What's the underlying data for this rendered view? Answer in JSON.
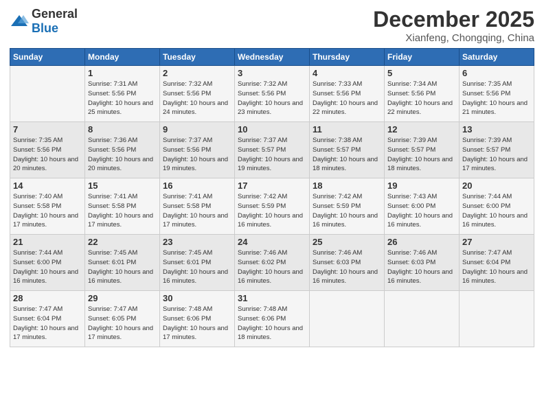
{
  "logo": {
    "general": "General",
    "blue": "Blue"
  },
  "header": {
    "month": "December 2025",
    "location": "Xianfeng, Chongqing, China"
  },
  "columns": [
    "Sunday",
    "Monday",
    "Tuesday",
    "Wednesday",
    "Thursday",
    "Friday",
    "Saturday"
  ],
  "weeks": [
    [
      {
        "day": "",
        "sunrise": "",
        "sunset": "",
        "daylight": ""
      },
      {
        "day": "1",
        "sunrise": "Sunrise: 7:31 AM",
        "sunset": "Sunset: 5:56 PM",
        "daylight": "Daylight: 10 hours and 25 minutes."
      },
      {
        "day": "2",
        "sunrise": "Sunrise: 7:32 AM",
        "sunset": "Sunset: 5:56 PM",
        "daylight": "Daylight: 10 hours and 24 minutes."
      },
      {
        "day": "3",
        "sunrise": "Sunrise: 7:32 AM",
        "sunset": "Sunset: 5:56 PM",
        "daylight": "Daylight: 10 hours and 23 minutes."
      },
      {
        "day": "4",
        "sunrise": "Sunrise: 7:33 AM",
        "sunset": "Sunset: 5:56 PM",
        "daylight": "Daylight: 10 hours and 22 minutes."
      },
      {
        "day": "5",
        "sunrise": "Sunrise: 7:34 AM",
        "sunset": "Sunset: 5:56 PM",
        "daylight": "Daylight: 10 hours and 22 minutes."
      },
      {
        "day": "6",
        "sunrise": "Sunrise: 7:35 AM",
        "sunset": "Sunset: 5:56 PM",
        "daylight": "Daylight: 10 hours and 21 minutes."
      }
    ],
    [
      {
        "day": "7",
        "sunrise": "Sunrise: 7:35 AM",
        "sunset": "Sunset: 5:56 PM",
        "daylight": "Daylight: 10 hours and 20 minutes."
      },
      {
        "day": "8",
        "sunrise": "Sunrise: 7:36 AM",
        "sunset": "Sunset: 5:56 PM",
        "daylight": "Daylight: 10 hours and 20 minutes."
      },
      {
        "day": "9",
        "sunrise": "Sunrise: 7:37 AM",
        "sunset": "Sunset: 5:56 PM",
        "daylight": "Daylight: 10 hours and 19 minutes."
      },
      {
        "day": "10",
        "sunrise": "Sunrise: 7:37 AM",
        "sunset": "Sunset: 5:57 PM",
        "daylight": "Daylight: 10 hours and 19 minutes."
      },
      {
        "day": "11",
        "sunrise": "Sunrise: 7:38 AM",
        "sunset": "Sunset: 5:57 PM",
        "daylight": "Daylight: 10 hours and 18 minutes."
      },
      {
        "day": "12",
        "sunrise": "Sunrise: 7:39 AM",
        "sunset": "Sunset: 5:57 PM",
        "daylight": "Daylight: 10 hours and 18 minutes."
      },
      {
        "day": "13",
        "sunrise": "Sunrise: 7:39 AM",
        "sunset": "Sunset: 5:57 PM",
        "daylight": "Daylight: 10 hours and 17 minutes."
      }
    ],
    [
      {
        "day": "14",
        "sunrise": "Sunrise: 7:40 AM",
        "sunset": "Sunset: 5:58 PM",
        "daylight": "Daylight: 10 hours and 17 minutes."
      },
      {
        "day": "15",
        "sunrise": "Sunrise: 7:41 AM",
        "sunset": "Sunset: 5:58 PM",
        "daylight": "Daylight: 10 hours and 17 minutes."
      },
      {
        "day": "16",
        "sunrise": "Sunrise: 7:41 AM",
        "sunset": "Sunset: 5:58 PM",
        "daylight": "Daylight: 10 hours and 17 minutes."
      },
      {
        "day": "17",
        "sunrise": "Sunrise: 7:42 AM",
        "sunset": "Sunset: 5:59 PM",
        "daylight": "Daylight: 10 hours and 16 minutes."
      },
      {
        "day": "18",
        "sunrise": "Sunrise: 7:42 AM",
        "sunset": "Sunset: 5:59 PM",
        "daylight": "Daylight: 10 hours and 16 minutes."
      },
      {
        "day": "19",
        "sunrise": "Sunrise: 7:43 AM",
        "sunset": "Sunset: 6:00 PM",
        "daylight": "Daylight: 10 hours and 16 minutes."
      },
      {
        "day": "20",
        "sunrise": "Sunrise: 7:44 AM",
        "sunset": "Sunset: 6:00 PM",
        "daylight": "Daylight: 10 hours and 16 minutes."
      }
    ],
    [
      {
        "day": "21",
        "sunrise": "Sunrise: 7:44 AM",
        "sunset": "Sunset: 6:00 PM",
        "daylight": "Daylight: 10 hours and 16 minutes."
      },
      {
        "day": "22",
        "sunrise": "Sunrise: 7:45 AM",
        "sunset": "Sunset: 6:01 PM",
        "daylight": "Daylight: 10 hours and 16 minutes."
      },
      {
        "day": "23",
        "sunrise": "Sunrise: 7:45 AM",
        "sunset": "Sunset: 6:01 PM",
        "daylight": "Daylight: 10 hours and 16 minutes."
      },
      {
        "day": "24",
        "sunrise": "Sunrise: 7:46 AM",
        "sunset": "Sunset: 6:02 PM",
        "daylight": "Daylight: 10 hours and 16 minutes."
      },
      {
        "day": "25",
        "sunrise": "Sunrise: 7:46 AM",
        "sunset": "Sunset: 6:03 PM",
        "daylight": "Daylight: 10 hours and 16 minutes."
      },
      {
        "day": "26",
        "sunrise": "Sunrise: 7:46 AM",
        "sunset": "Sunset: 6:03 PM",
        "daylight": "Daylight: 10 hours and 16 minutes."
      },
      {
        "day": "27",
        "sunrise": "Sunrise: 7:47 AM",
        "sunset": "Sunset: 6:04 PM",
        "daylight": "Daylight: 10 hours and 16 minutes."
      }
    ],
    [
      {
        "day": "28",
        "sunrise": "Sunrise: 7:47 AM",
        "sunset": "Sunset: 6:04 PM",
        "daylight": "Daylight: 10 hours and 17 minutes."
      },
      {
        "day": "29",
        "sunrise": "Sunrise: 7:47 AM",
        "sunset": "Sunset: 6:05 PM",
        "daylight": "Daylight: 10 hours and 17 minutes."
      },
      {
        "day": "30",
        "sunrise": "Sunrise: 7:48 AM",
        "sunset": "Sunset: 6:06 PM",
        "daylight": "Daylight: 10 hours and 17 minutes."
      },
      {
        "day": "31",
        "sunrise": "Sunrise: 7:48 AM",
        "sunset": "Sunset: 6:06 PM",
        "daylight": "Daylight: 10 hours and 18 minutes."
      },
      {
        "day": "",
        "sunrise": "",
        "sunset": "",
        "daylight": ""
      },
      {
        "day": "",
        "sunrise": "",
        "sunset": "",
        "daylight": ""
      },
      {
        "day": "",
        "sunrise": "",
        "sunset": "",
        "daylight": ""
      }
    ]
  ]
}
